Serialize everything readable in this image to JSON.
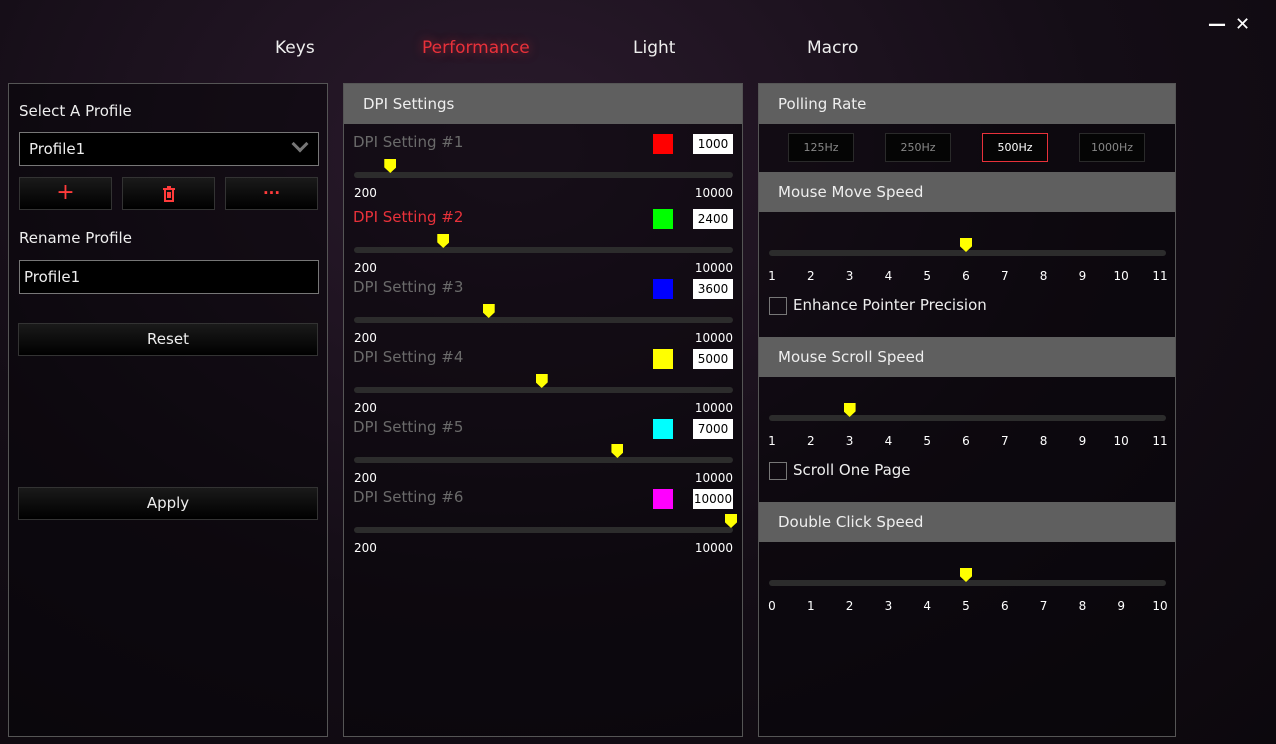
{
  "tabs": [
    {
      "label": "Keys"
    },
    {
      "label": "Performance",
      "active": true
    },
    {
      "label": "Light"
    },
    {
      "label": "Macro"
    }
  ],
  "window": {
    "minimize": "—",
    "close": "✕"
  },
  "profile": {
    "select_label": "Select A Profile",
    "selected": "Profile1",
    "add_icon": "+",
    "delete_icon": "trash-icon",
    "more_icon": "···",
    "rename_label": "Rename Profile",
    "rename_value": "Profile1",
    "reset": "Reset",
    "apply": "Apply"
  },
  "dpi": {
    "title": "DPI Settings",
    "min": "200",
    "max": "10000",
    "settings": [
      {
        "name": "DPI Setting #1",
        "color": "#ff0000",
        "value": "1000",
        "selected": false
      },
      {
        "name": "DPI Setting #2",
        "color": "#00ff00",
        "value": "2400",
        "selected": true
      },
      {
        "name": "DPI Setting #3",
        "color": "#0000ff",
        "value": "3600",
        "selected": false
      },
      {
        "name": "DPI Setting #4",
        "color": "#ffff00",
        "value": "5000",
        "selected": false
      },
      {
        "name": "DPI Setting #5",
        "color": "#00ffff",
        "value": "7000",
        "selected": false
      },
      {
        "name": "DPI Setting #6",
        "color": "#ff00ff",
        "value": "10000",
        "selected": false
      }
    ]
  },
  "polling": {
    "title": "Polling Rate",
    "options": [
      "125Hz",
      "250Hz",
      "500Hz",
      "1000Hz"
    ],
    "selected": "500Hz"
  },
  "move": {
    "title": "Mouse Move Speed",
    "ticks": [
      "1",
      "2",
      "3",
      "4",
      "5",
      "6",
      "7",
      "8",
      "9",
      "10",
      "11"
    ],
    "value": 6,
    "checkbox": "Enhance Pointer Precision",
    "checked": false
  },
  "scroll": {
    "title": "Mouse Scroll Speed",
    "ticks": [
      "1",
      "2",
      "3",
      "4",
      "5",
      "6",
      "7",
      "8",
      "9",
      "10",
      "11"
    ],
    "value": 3,
    "checkbox": "Scroll One Page",
    "checked": false
  },
  "dblclick": {
    "title": "Double Click Speed",
    "ticks": [
      "0",
      "1",
      "2",
      "3",
      "4",
      "5",
      "6",
      "7",
      "8",
      "9",
      "10"
    ],
    "value": 5
  },
  "accent": "#e8313a"
}
